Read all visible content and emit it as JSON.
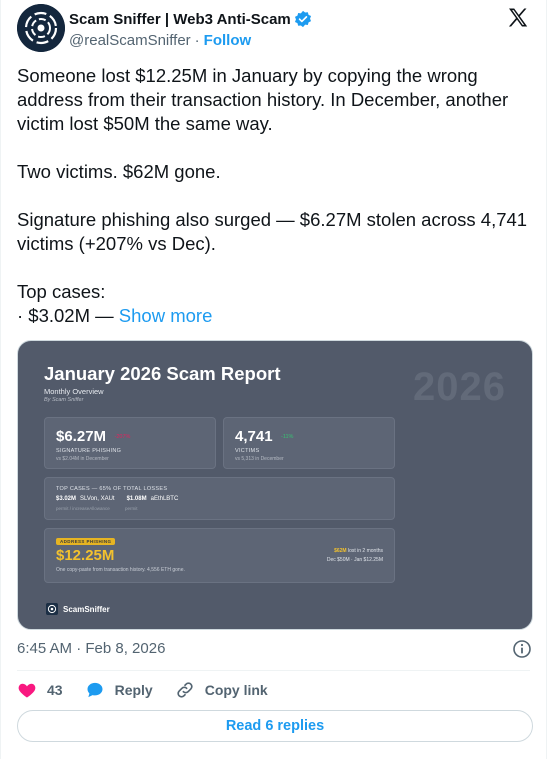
{
  "header": {
    "name": "Scam Sniffer | Web3 Anti-Scam",
    "handle": "@realScamSniffer",
    "separator": "·",
    "follow": "Follow"
  },
  "tweet": {
    "p1": "Someone lost $12.25M in January by copying the wrong address from their transaction history. In December, another victim lost $50M the same way.",
    "p2": "Two victims. $62M gone.",
    "p3": "Signature phishing also surged — $6.27M stolen across 4,741 victims (+207% vs Dec).",
    "p4": "Top cases:",
    "p5_prefix": "· $3.02M —",
    "show_more": "Show more"
  },
  "report": {
    "title": "January 2026 Scam Report",
    "subtitle": "Monthly Overview",
    "by": "By Scam Sniffer",
    "year_watermark": "2026",
    "stat1": {
      "value": "$6.27M",
      "change": "-207%",
      "label": "SIGNATURE PHISHING",
      "sub": "vs $2.04M in December",
      "change_color": "#e0245e"
    },
    "stat2": {
      "value": "4,741",
      "change": "-11%",
      "label": "VICTIMS",
      "sub": "vs 5,313 in December",
      "change_color": "#38c172"
    },
    "top_cases": {
      "header": "TOP CASES — 65% OF TOTAL LOSSES",
      "case1_value": "$3.02M",
      "case1_tokens": "SLVon, XAUt",
      "case2_value": "$1.08M",
      "case2_tokens": "aEthLBTC",
      "case1_method": "permit / increaseAllowance",
      "case2_method": "permit"
    },
    "address_phishing": {
      "badge": "ADDRESS PHISHING",
      "value": "$12.25M",
      "sub": "One copy-paste from transaction history. 4,556 ETH gone.",
      "right_highlight": "$62M",
      "right_line1": " lost in 2 months",
      "right_line2": "Dec $50M · Jan $12.25M"
    },
    "brand": "ScamSniffer"
  },
  "timestamp": "6:45 AM · Feb 8, 2026",
  "actions": {
    "likes": "43",
    "reply": "Reply",
    "copy_link": "Copy link"
  },
  "read_replies": "Read 6 replies",
  "colors": {
    "accent": "#1d9bf0",
    "like": "#f91880",
    "report_bg": "#525a6a",
    "highlight": "#f2c12e"
  }
}
